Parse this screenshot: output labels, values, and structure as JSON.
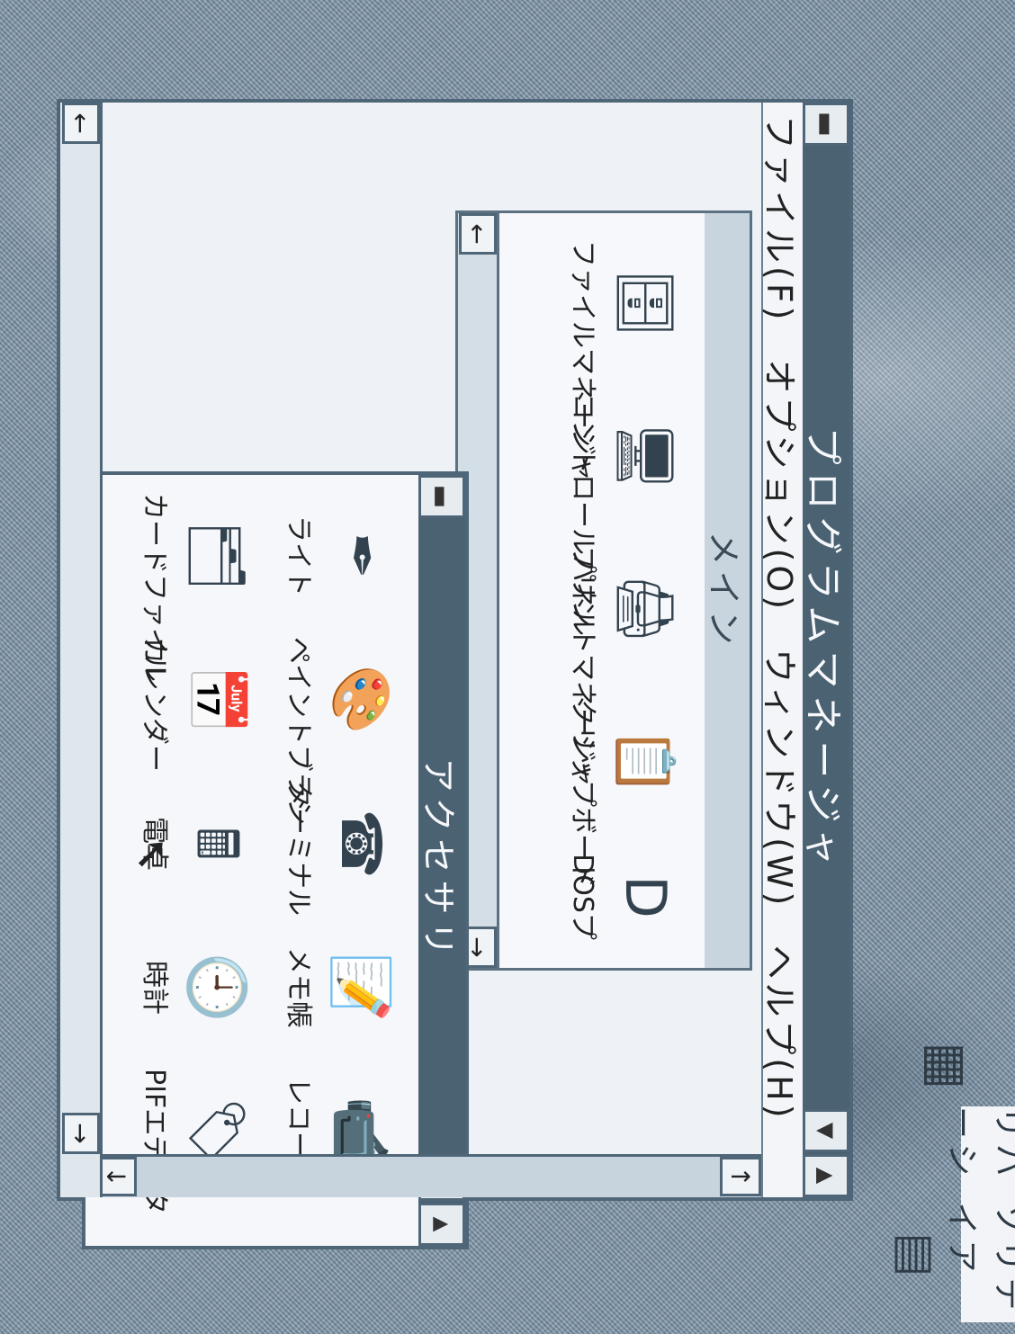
{
  "program_manager": {
    "title": "プログラムマネージャ",
    "menu": [
      "ファイル(F)",
      "オプション(O)",
      "ウィンドウ(W)",
      "ヘルプ(H)"
    ]
  },
  "main_group": {
    "title": "メイン",
    "items": [
      {
        "label": "ファイルマネージャ",
        "icon": "file-manager-icon",
        "glyph": "🗄"
      },
      {
        "label": "コントロールパネル",
        "icon": "control-panel-icon",
        "glyph": "🖥"
      },
      {
        "label": "プリントマネージャ",
        "icon": "print-manager-icon",
        "glyph": "🖨"
      },
      {
        "label": "クリップボード",
        "icon": "clipboard-icon",
        "glyph": "📋"
      },
      {
        "label": "DOSプ",
        "icon": "dos-prompt-icon",
        "glyph": "D"
      }
    ]
  },
  "accessories": {
    "title": "アクセサリ",
    "items": [
      {
        "label": "ライト",
        "icon": "write-icon",
        "glyph": "✒"
      },
      {
        "label": "ペイントブラシ",
        "icon": "paintbrush-icon",
        "glyph": "🎨"
      },
      {
        "label": "ターミナル",
        "icon": "terminal-icon",
        "glyph": "☎"
      },
      {
        "label": "メモ帳",
        "icon": "notepad-icon",
        "glyph": "📝"
      },
      {
        "label": "レコーダ",
        "icon": "recorder-icon",
        "glyph": "📹"
      },
      {
        "label": "カードファイル",
        "icon": "cardfile-icon",
        "glyph": "🗂"
      },
      {
        "label": "カレンダー",
        "icon": "calendar-icon",
        "glyph": "📅"
      },
      {
        "label": "電卓",
        "icon": "calculator-icon",
        "glyph": "🖩"
      },
      {
        "label": "時計",
        "icon": "clock-icon",
        "glyph": "🕘"
      },
      {
        "label": "PIFエディタ",
        "icon": "pif-editor-icon",
        "glyph": "🏷"
      }
    ]
  },
  "desktop": {
    "reversi_label": "リバーシ",
    "reversi_suffix": "ソリテイア"
  },
  "buttons": {
    "sys": "▬",
    "min": "▼",
    "max": "▲",
    "left": "←",
    "right": "→",
    "up": "↑",
    "down": "↓"
  }
}
